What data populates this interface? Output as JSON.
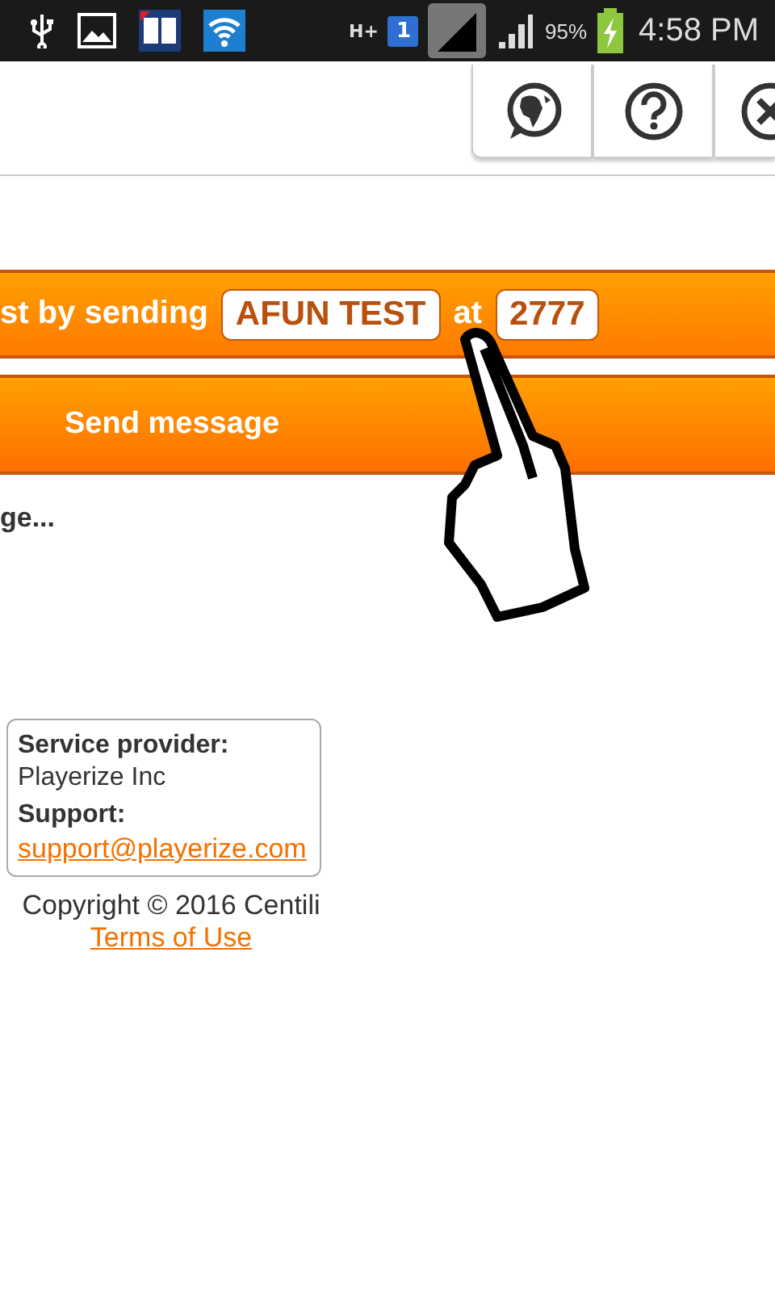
{
  "status_bar": {
    "network": "H+",
    "sim": "1",
    "battery": "95%",
    "time": "4:58 PM"
  },
  "toolbar": {
    "buttons": [
      {
        "kind": "language"
      },
      {
        "kind": "help"
      },
      {
        "kind": "close"
      }
    ]
  },
  "instruction": {
    "text": "st by sending",
    "keyword": "AFUN TEST",
    "connector": "at",
    "shortcode": "2777"
  },
  "send_button": "Send message",
  "status_text": "ge...",
  "info": {
    "provider_label": "Service provider:",
    "provider": "Playerize Inc",
    "support_label": "Support:",
    "support_email": "support@playerize.com"
  },
  "copyright": "Copyright © 2016 Centili",
  "terms_link": "Terms of Use"
}
